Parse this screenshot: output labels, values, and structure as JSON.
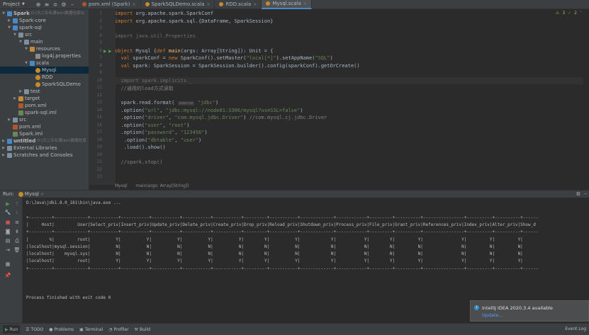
{
  "toolbar": {
    "project_label": "Project",
    "tabs": [
      {
        "label": "pom.xml (Spark)",
        "active": false
      },
      {
        "label": "SparkSQLDemo.scala",
        "active": false
      },
      {
        "label": "RDD.scala",
        "active": false
      },
      {
        "label": "Mysql.scala",
        "active": true
      }
    ]
  },
  "project_tree": [
    {
      "indent": 0,
      "label": "Spark",
      "suffix": "D:\\大二专业课\\bin\\数据仓库\\S",
      "icon": "folder-blue",
      "open": true
    },
    {
      "indent": 1,
      "label": "Spark-core",
      "icon": "folder-blue",
      "open": false
    },
    {
      "indent": 1,
      "label": "spark-sql",
      "icon": "folder-blue",
      "open": true
    },
    {
      "indent": 2,
      "label": "src",
      "icon": "folder",
      "open": true
    },
    {
      "indent": 3,
      "label": "main",
      "icon": "folder",
      "open": true
    },
    {
      "indent": 4,
      "label": "resources",
      "icon": "folder-orange",
      "open": true
    },
    {
      "indent": 5,
      "label": "log4j.properties",
      "icon": "file-prop"
    },
    {
      "indent": 4,
      "label": "scala",
      "icon": "folder-blue",
      "open": true
    },
    {
      "indent": 5,
      "label": "Mysql",
      "icon": "obj",
      "selected": true
    },
    {
      "indent": 5,
      "label": "RDD",
      "icon": "obj"
    },
    {
      "indent": 5,
      "label": "SparkSQLDemo",
      "icon": "obj"
    },
    {
      "indent": 3,
      "label": "test",
      "icon": "folder",
      "open": false
    },
    {
      "indent": 2,
      "label": "target",
      "icon": "folder-orange",
      "open": false
    },
    {
      "indent": 2,
      "label": "pom.xml",
      "icon": "file-xml"
    },
    {
      "indent": 2,
      "label": "spark-sql.iml",
      "icon": "file-iml"
    },
    {
      "indent": 1,
      "label": "src",
      "icon": "folder",
      "open": false
    },
    {
      "indent": 1,
      "label": "pom.xml",
      "icon": "file-xml"
    },
    {
      "indent": 1,
      "label": "Spark.iml",
      "icon": "file-iml"
    },
    {
      "indent": 0,
      "label": "untitled",
      "suffix": "D:\\大二专业课\\bin\\数据仓库",
      "icon": "folder-blue",
      "open": false
    },
    {
      "indent": 0,
      "label": "External Libraries",
      "icon": "folder",
      "open": false
    },
    {
      "indent": 0,
      "label": "Scratches and Consoles",
      "icon": "folder",
      "open": false
    }
  ],
  "editor": {
    "warnings": "3",
    "weak_warnings": "2",
    "lines": [
      {
        "n": "1",
        "html": "<span class='kw'>import</span> org.apache.spark.SparkConf"
      },
      {
        "n": "2",
        "html": "<span class='kw'>import</span> org.apache.spark.sql.{DataFrame, SparkSession}"
      },
      {
        "n": "3",
        "html": ""
      },
      {
        "n": "4",
        "html": "<span class='gray'>import java.util.Properties</span>"
      },
      {
        "n": "5",
        "html": ""
      },
      {
        "n": "6",
        "html": "<span class='kw'>object</span> Mysql {<span class='kw'>def</span> <span class='fn'>main</span>(args: Array[String]): Unit = {"
      },
      {
        "n": "7",
        "html": "  <span class='kw'>val</span> sparkConf = <span class='kw'>new</span> SparkConf().setMaster(<span class='str'>\"local[*]\"</span>).setAppName(<span class='str'>\"SQL\"</span>)"
      },
      {
        "n": "8",
        "html": "  <span class='kw'>val</span> spark: SparkSession = SparkSession.builder().config(sparkConf).getOrCreate()"
      },
      {
        "n": "9",
        "html": ""
      },
      {
        "n": "10",
        "html": "  <span class='gray'>import spark.implicits._</span>"
      },
      {
        "n": "11",
        "html": "  <span class='cm'>//通用的load方式读取</span>"
      },
      {
        "n": "12",
        "html": ""
      },
      {
        "n": "13",
        "html": "  spark.read.format( <span class='hint'>source</span> <span class='str'>\"jdbc\"</span>)"
      },
      {
        "n": "14",
        "html": "  .option(<span class='str'>\"url\"</span>, <span class='str'>\"jdbc:mysql://node01:3306/mysql?useSSL=false\"</span>)"
      },
      {
        "n": "15",
        "html": "  .option(<span class='str'>\"driver\"</span>, <span class='str'>\"com.mysql.jdbc.Driver\"</span>) <span class='cm'>//com.mysql.cj.jdbc.Driver</span>"
      },
      {
        "n": "16",
        "html": "  .option(<span class='str'>\"user\"</span>, <span class='str'>\"root\"</span>)"
      },
      {
        "n": "17",
        "html": "  .option(<span class='str'>\"password\"</span>, <span class='str'>\"123456\"</span>)"
      },
      {
        "n": "18",
        "html": "   .option(<span class='str'>\"dbtable\"</span>, <span class='str'>\"user\"</span>)"
      },
      {
        "n": "19",
        "html": "   .load().show()"
      },
      {
        "n": "20",
        "html": ""
      },
      {
        "n": "21",
        "html": "  <span class='cm'>//spark.stop()</span>"
      },
      {
        "n": "22",
        "html": ""
      },
      {
        "n": "23",
        "html": ""
      }
    ],
    "breadcrumb_object": "Mysql",
    "breadcrumb_method": "main(args: Array[String])"
  },
  "run": {
    "label": "Run:",
    "config": "Mysql",
    "console": [
      "D:\\Java\\jdk1.8.0_181\\bin\\java.exe ...",
      "",
      "+---------+-------------+-----------+-----------+-----------+-----------+-----------+---------+-----------+-------------+------------+---------+----------+----------------+----------+----------+------",
      "|     Host|         User|Select_priv|Insert_priv|Update_priv|Delete_priv|Create_priv|Drop_priv|Reload_priv|Shutdown_priv|Process_priv|File_priv|Grant_priv|References_priv|Index_priv|Alter_priv|Show_d",
      "+---------+-------------+-----------+-----------+-----------+-----------+-----------+---------+-----------+-------------+------------+---------+----------+----------------+----------+----------+------",
      "|        %|         root|          Y|          Y|          Y|          Y|          Y|        Y|          Y|            Y|           Y|        Y|         Y|               Y|         Y|         Y|",
      "|localhost|mysql.session|          N|          N|          N|          N|          N|        N|          N|            N|           N|        N|         N|               N|         N|         N|",
      "|localhost|    mysql.sys|          N|          N|          N|          N|          N|        N|          N|            N|           N|        N|         N|               N|         N|         N|",
      "|localhost|         root|          Y|          Y|          Y|          Y|          Y|        Y|          Y|            Y|           Y|        Y|         Y|               Y|         Y|         Y|",
      "+---------+-------------+-----------+-----------+-----------+-----------+-----------+---------+-----------+-------------+------------+---------+----------+----------------+----------+----------+------",
      "",
      "",
      "",
      "Process finished with exit code 0"
    ]
  },
  "notification": {
    "title": "IntelliJ IDEA 2020.3.4 available",
    "link": "Update..."
  },
  "statusbar": {
    "items": [
      "Run",
      "TODO",
      "Problems",
      "Terminal",
      "Profiler",
      "Build"
    ],
    "event_log": "Event Log"
  }
}
